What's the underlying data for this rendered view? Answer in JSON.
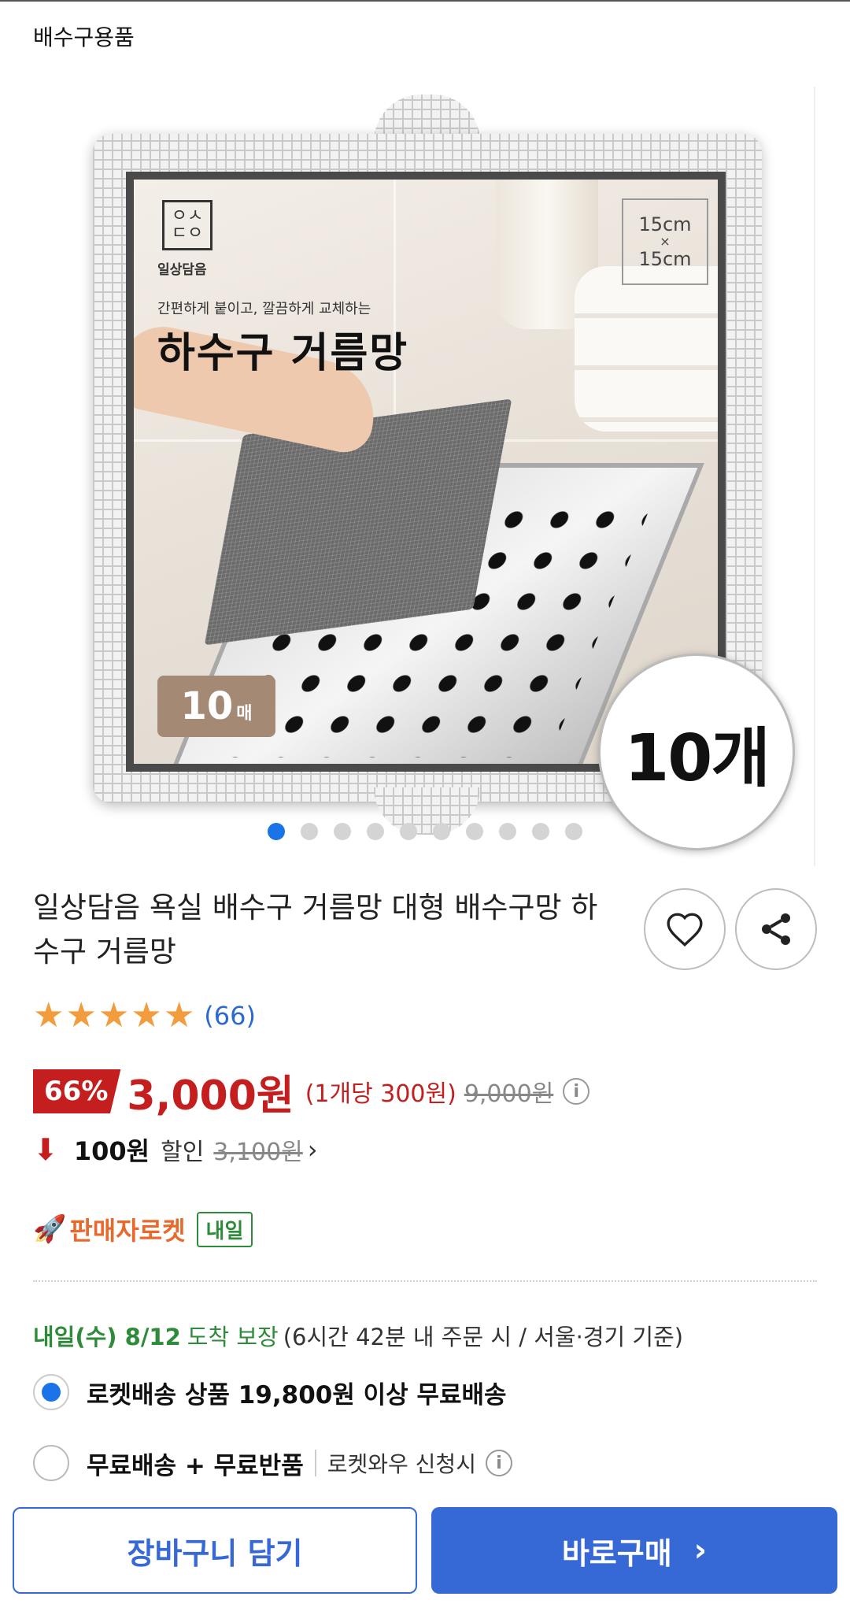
{
  "breadcrumb": "배수구용품",
  "product_image": {
    "brand_logo_text": "ㅇㅅ\nㄷㅇ",
    "brand_name": "일상담음",
    "tagline": "간편하게 붙이고, 깔끔하게 교체하는",
    "headline": "하수구 거름망",
    "size_top": "15cm",
    "size_x": "×",
    "size_bottom": "15cm",
    "count_value": "10",
    "count_unit": "매",
    "pack_badge": "10개"
  },
  "carousel": {
    "total": 10,
    "active_index": 0
  },
  "product_title": "일상담음 욕실 배수구 거름망 대형 배수구망 하수구 거름망",
  "rating": {
    "stars": 5,
    "review_count": "(66)"
  },
  "price": {
    "discount_rate": "66%",
    "sale_price": "3,000원",
    "unit_price": "(1개당 300원)",
    "original_price": "9,000원"
  },
  "price_drop": {
    "amount": "100원",
    "label": "할인",
    "previous_price": "3,100원"
  },
  "seller_rocket": {
    "label": "판매자로켓",
    "badge": "내일"
  },
  "delivery": {
    "date": "내일(수) 8/12",
    "guarantee": "도착 보장",
    "condition": "(6시간 42분 내 주문 시 / 서울·경기 기준)"
  },
  "shipping_options": [
    {
      "label": "로켓배송 상품 19,800원 이상 무료배송",
      "selected": true
    },
    {
      "label": "무료배송 + 무료반품",
      "sub": "로켓와우 신청시",
      "selected": false
    }
  ],
  "actions": {
    "cart_label": "장바구니 담기",
    "buy_label": "바로구매"
  },
  "colors": {
    "accent_blue": "#3668d6",
    "price_red": "#c41e1e",
    "rocket_orange": "#e8692c",
    "delivery_green": "#2e8b3a",
    "star_orange": "#f39c3d"
  }
}
